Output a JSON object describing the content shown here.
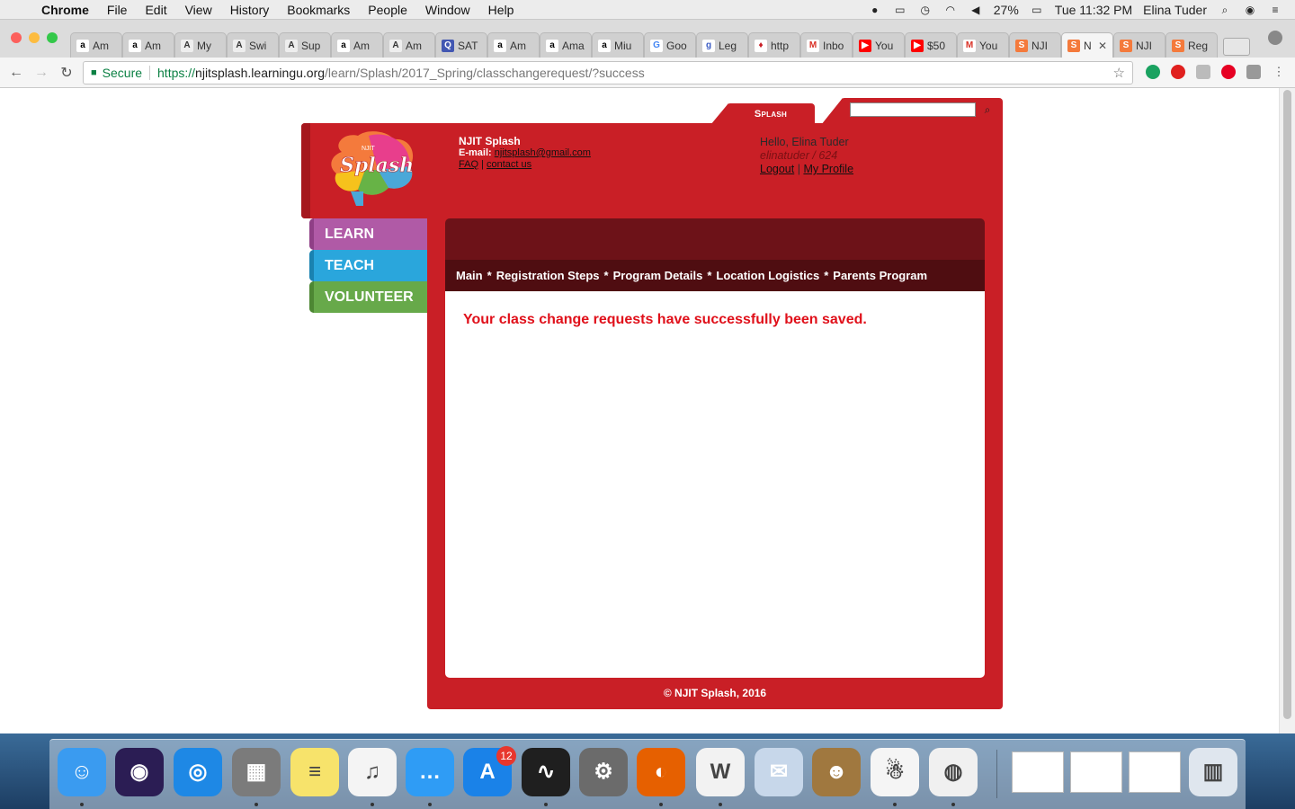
{
  "menubar": {
    "app": "Chrome",
    "items": [
      "File",
      "Edit",
      "View",
      "History",
      "Bookmarks",
      "People",
      "Window",
      "Help"
    ],
    "battery": "27%",
    "clock": "Tue 11:32 PM",
    "user": "Elina Tuder"
  },
  "tabs": [
    {
      "label": "Am",
      "icon": "amazon-icon"
    },
    {
      "label": "Am",
      "icon": "amazon-icon"
    },
    {
      "label": "My",
      "icon": "aeo-icon"
    },
    {
      "label": "Swi",
      "icon": "aeo-icon"
    },
    {
      "label": "Sup",
      "icon": "aeo-icon"
    },
    {
      "label": "Am",
      "icon": "amazon-icon"
    },
    {
      "label": "Am",
      "icon": "aeo-icon"
    },
    {
      "label": "SAT",
      "icon": "quizlet-icon"
    },
    {
      "label": "Am",
      "icon": "amazon-icon"
    },
    {
      "label": "Ama",
      "icon": "amazon-icon"
    },
    {
      "label": "Miu",
      "icon": "amazon-icon"
    },
    {
      "label": "Goo",
      "icon": "google-icon"
    },
    {
      "label": "Leg",
      "icon": "search-icon"
    },
    {
      "label": "http",
      "icon": "shield-icon"
    },
    {
      "label": "Inbo",
      "icon": "gmail-icon"
    },
    {
      "label": "You",
      "icon": "youtube-icon"
    },
    {
      "label": "$50",
      "icon": "youtube-icon"
    },
    {
      "label": "You",
      "icon": "gmail-icon"
    },
    {
      "label": "NJI",
      "icon": "splash-icon"
    },
    {
      "label": "N",
      "icon": "splash-icon",
      "active": true
    },
    {
      "label": "NJI",
      "icon": "splash-icon"
    },
    {
      "label": "Reg",
      "icon": "splash-icon"
    }
  ],
  "toolbar": {
    "secure_label": "Secure",
    "url_scheme": "https://",
    "url_host": "njitsplash.learningu.org",
    "url_path": "/learn/Splash/2017_Spring/classchangerequest/?success"
  },
  "site": {
    "program_tab": "Splash",
    "search_placeholder": "",
    "org_name": "NJIT Splash",
    "email_label": "E-mail:",
    "email": "njitsplash@gmail.com",
    "faq": "FAQ",
    "divider": "|",
    "contact": "contact us",
    "greeting": "Hello, Elina Tuder",
    "username": "elinatuder / 624",
    "logout": "Logout",
    "profile": "My Profile",
    "logo_small": "NJIT",
    "logo_text": "Splash"
  },
  "sidenav": [
    {
      "label": "LEARN",
      "color": "#b05aa6",
      "edge": "#8f3f86"
    },
    {
      "label": "TEACH",
      "color": "#2aa6dc",
      "edge": "#1a82b0"
    },
    {
      "label": "VOLUNTEER",
      "color": "#67a94a",
      "edge": "#4d8733"
    }
  ],
  "subnav": [
    "Main",
    "Registration Steps",
    "Program Details",
    "Location Logistics",
    "Parents Program"
  ],
  "subnav_separator": "*",
  "message": "Your class change requests have successfully been saved.",
  "footer": "© NJIT Splash, 2016",
  "colors": {
    "brand_red": "#c91f26",
    "dark_red": "#6d1218",
    "message_red": "#e0101a"
  },
  "dock": {
    "appstore_badge": "12",
    "apps": [
      "finder-icon",
      "siri-icon",
      "safari-icon",
      "calculator-icon",
      "notes-icon",
      "itunes-icon",
      "messages-icon",
      "app-store-icon",
      "activity-monitor-icon",
      "system-preferences-icon",
      "firefox-icon",
      "word-icon",
      "mail-preview-icon",
      "contacts-icon",
      "robot-icon",
      "chrome-icon",
      "trash-icon"
    ]
  }
}
